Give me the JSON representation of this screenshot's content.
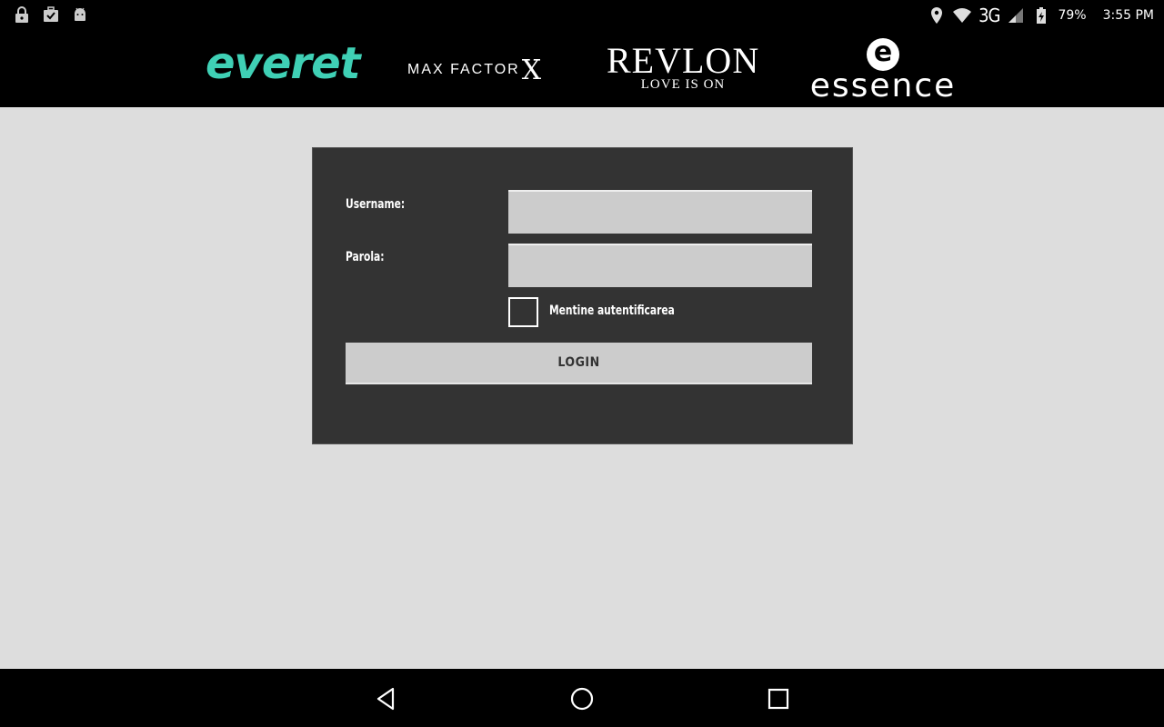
{
  "status_bar": {
    "left_icons": [
      "lock-icon",
      "briefcase-check-icon",
      "android-icon"
    ],
    "network": "3G",
    "battery": "79%",
    "time": "3:55 PM"
  },
  "brands": {
    "everet": "everet",
    "maxfactor": "MAX FACTOR",
    "maxfactor_x": "X",
    "revlon": "REVLON",
    "revlon_tagline": "LOVE IS ON",
    "essence_mark": "e",
    "essence": "essence"
  },
  "login": {
    "username_label": "Username:",
    "username_value": "",
    "password_label": "Parola:",
    "password_value": "",
    "remember_label": "Mentine autentificarea",
    "remember_checked": false,
    "login_button": "LOGIN"
  },
  "colors": {
    "everet_brand": "#3fd0b5",
    "panel_bg": "#333333",
    "page_bg": "#dddddd"
  }
}
